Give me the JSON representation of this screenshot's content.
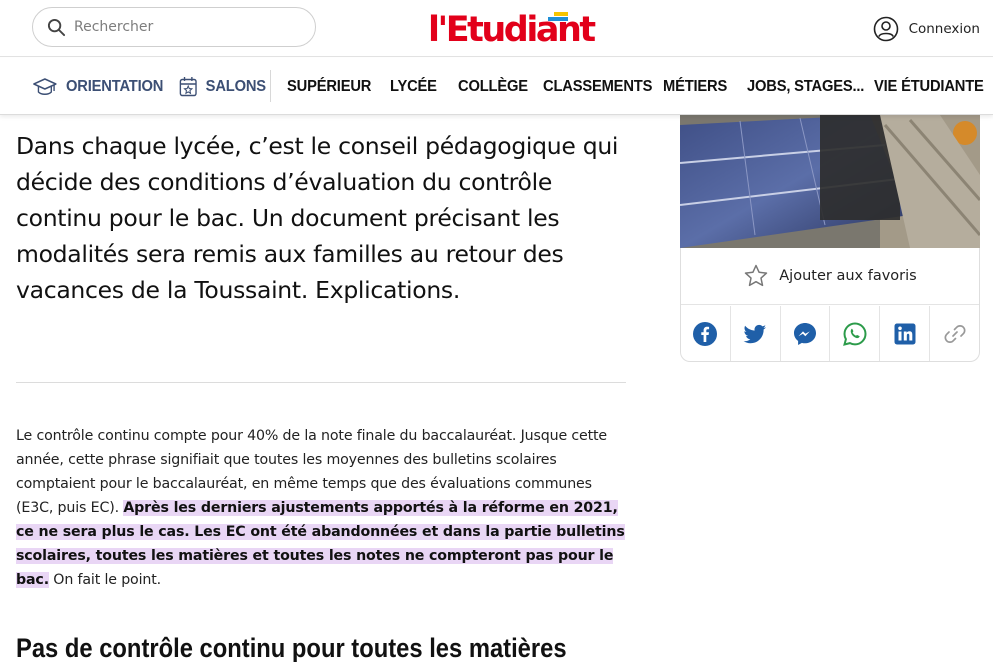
{
  "header": {
    "search_placeholder": "Rechercher",
    "logo_text": "l'Etudiant",
    "login_label": "Connexion"
  },
  "nav": {
    "items": [
      {
        "label": "ORIENTATION"
      },
      {
        "label": "SALONS"
      },
      {
        "label": "SUPÉRIEUR"
      },
      {
        "label": "LYCÉE"
      },
      {
        "label": "COLLÈGE"
      },
      {
        "label": "CLASSEMENTS"
      },
      {
        "label": "MÉTIERS"
      },
      {
        "label": "JOBS, STAGES..."
      },
      {
        "label": "VIE ÉTUDIANTE"
      }
    ]
  },
  "article": {
    "lead": "Dans chaque lycée, c’est le conseil pédagogique qui décide des conditions d’évaluation du contrôle continu pour le bac. Un document précisant les modalités sera remis aux familles au retour des vacances de la Toussaint. Explications.",
    "body_plain_1": "Le contrôle continu compte pour 40% de la note finale du baccalauréat. Jusque cette année, cette phrase signifiait que toutes les moyennes des bulletins scolaires comptaient pour le baccalauréat, en même temps que des évaluations communes (E3C, puis EC). ",
    "body_highlight": "Après les derniers ajustements apportés à la réforme en 2021, ce ne sera plus le cas. Les EC ont été abandonnées et dans la partie bulletins scolaires, toutes les matières et toutes les notes ne compteront pas pour le bac.",
    "body_plain_2": " On fait le point.",
    "section_title": "Pas de contrôle continu pour toutes les matières"
  },
  "sidebar": {
    "favorite_label": "Ajouter aux favoris",
    "share_buttons": [
      "facebook-icon",
      "twitter-icon",
      "messenger-icon",
      "whatsapp-icon",
      "linkedin-icon",
      "link-icon"
    ]
  },
  "colors": {
    "brand_red": "#e2001a",
    "nav_blue": "#3c4f74",
    "highlight": "#e9d6f5",
    "share_blue": "#1f5fa8",
    "whatsapp_green": "#2c9b4a"
  }
}
